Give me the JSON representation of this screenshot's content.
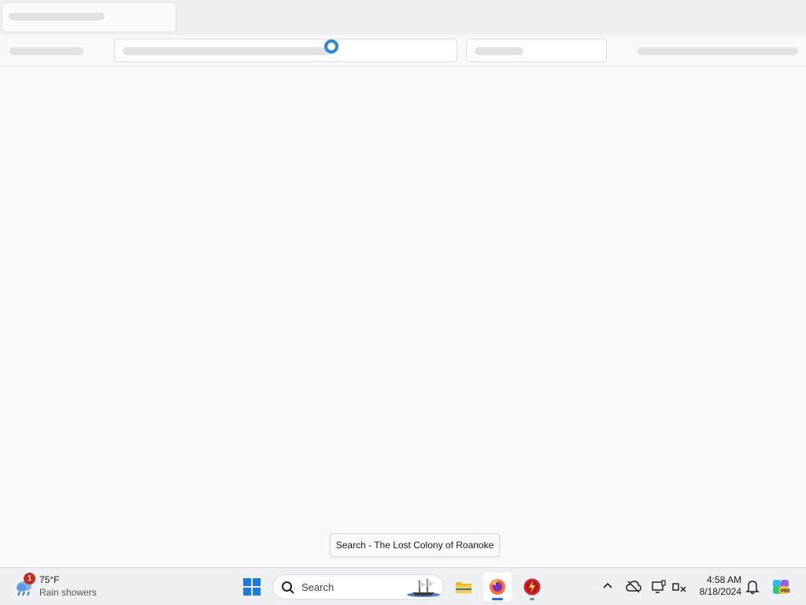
{
  "tooltip": {
    "text": "Search - The Lost Colony of Roanoke"
  },
  "taskbar": {
    "weather": {
      "badge": "1",
      "temperature": "75°F",
      "condition": "Rain showers",
      "icon": "weather-rain-icon"
    },
    "search": {
      "label": "Search",
      "icon": "search-icon"
    },
    "apps": [
      {
        "name": "File Explorer",
        "icon": "folder-icon"
      },
      {
        "name": "Firefox",
        "icon": "firefox-icon",
        "active": true
      },
      {
        "name": "App",
        "icon": "red-app-icon"
      }
    ],
    "tray": {
      "icons": [
        "chevron-up-icon",
        "cloud-off-icon",
        "display-icon",
        "network-icon"
      ]
    },
    "clock": {
      "time": "4:58 AM",
      "date": "8/18/2024"
    }
  },
  "colors": {
    "accent": "#2b8ad8",
    "badge": "#c42b1c",
    "taskbar": "#eef0f4"
  }
}
